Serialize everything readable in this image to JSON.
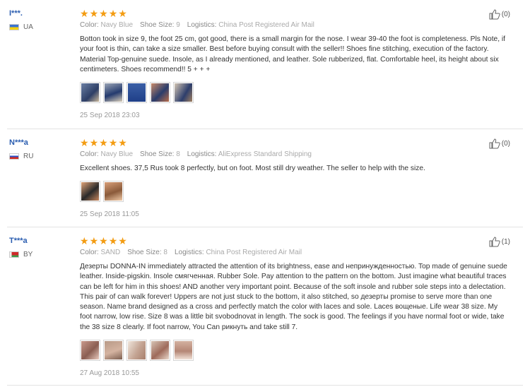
{
  "reviews": [
    {
      "user": "I***.",
      "country": "UA",
      "rating": 5,
      "color_label": "Color:",
      "color_value": "Navy Blue",
      "size_label": "Shoe Size:",
      "size_value": "9",
      "logistics_label": "Logistics:",
      "logistics_value": "China Post Registered Air Mail",
      "text": "Botton took in size 9, the foot 25 cm, got good, there is a small margin for the nose. I wear 39-40 the foot is completeness. Pls Note, if your foot is thin, can take a size smaller. Best before buying consult with the seller!! Shoes fine stitching, execution of the factory. Material Top-genuine suede. Insole, as I already mentioned, and leather. Sole rubberized, flat. Comfortable heel, its height about six centimeters. Shoes recommend!! 5 + + +",
      "photos": [
        "photo-1",
        "photo-2",
        "photo-3",
        "photo-4",
        "photo-5"
      ],
      "date": "25 Sep 2018 23:03",
      "helpful": "(0)"
    },
    {
      "user": "N***a",
      "country": "RU",
      "rating": 5,
      "color_label": "Color:",
      "color_value": "Navy Blue",
      "size_label": "Shoe Size:",
      "size_value": "8",
      "logistics_label": "Logistics:",
      "logistics_value": "AliExpress Standard Shipping",
      "text": "Excellent shoes. 37,5 Rus took 8 perfectly, but on foot. Most still dry weather. The seller to help with the size.",
      "photos": [
        "photo-1",
        "photo-2"
      ],
      "date": "25 Sep 2018 11:05",
      "helpful": "(0)"
    },
    {
      "user": "T***a",
      "country": "BY",
      "rating": 5,
      "color_label": "Color:",
      "color_value": "SAND",
      "size_label": "Shoe Size:",
      "size_value": "8",
      "logistics_label": "Logistics:",
      "logistics_value": "China Post Registered Air Mail",
      "text": "Дезерты DONNA-IN immediately attracted the attention of its brightness, ease and непринужденностью. Top made of genuine suede leather. Inside-pigskin. Insole смягченная. Rubber Sole. Pay attention to the pattern on the bottom. Just imagine what beautiful traces can be left for him in this shoes! AND another very important point. Because of the soft insole and rubber sole steps into a delectation. This pair of can walk forever! Uppers are not just stuck to the bottom, it also stitched, so дезерты promise to serve more than one season. Name brand designed as a cross and perfectly match the color with laces and sole. Laces вощеные. Life wear 38 size. My foot narrow, low rise. Size 8 was a little bit svobodnovat in length. The sock is good. The feelings if you have normal foot or wide, take the 38 size 8 clearly. If foot narrow, You Can рикнуть and take still 7.",
      "photos": [
        "photo-1",
        "photo-2",
        "photo-3",
        "photo-4",
        "photo-5"
      ],
      "date": "27 Aug 2018 10:55",
      "helpful": "(1)"
    }
  ],
  "colors": {
    "star": "#f39c12",
    "username": "#2a5db0"
  }
}
